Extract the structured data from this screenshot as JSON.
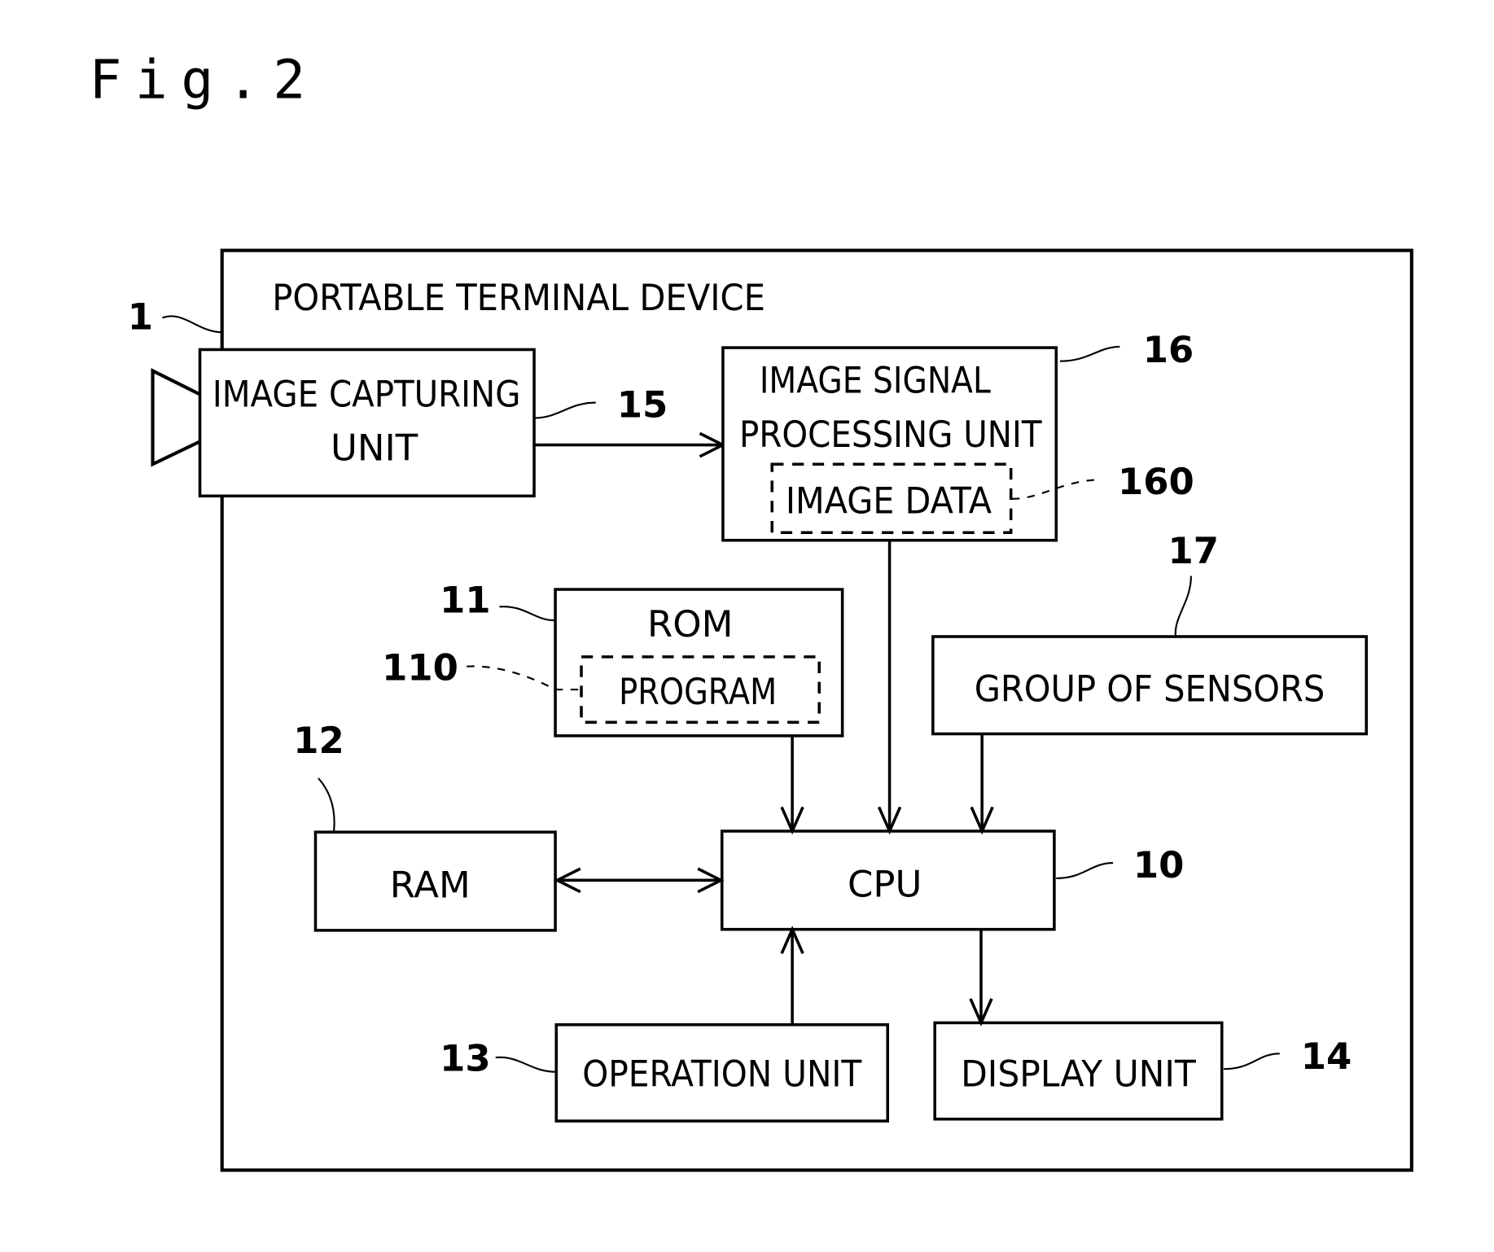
{
  "figure": {
    "title": "Fig.2",
    "device_label": "PORTABLE TERMINAL DEVICE",
    "device_ref": "1"
  },
  "blocks": {
    "image_capturing": {
      "line1": "IMAGE CAPTURING",
      "line2": "UNIT",
      "ref": "15"
    },
    "image_signal": {
      "line1": "IMAGE SIGNAL",
      "line2": "PROCESSING UNIT",
      "ref": "16"
    },
    "image_data": {
      "label": "IMAGE DATA",
      "ref": "160"
    },
    "rom": {
      "label": "ROM",
      "ref": "11"
    },
    "program": {
      "label": "PROGRAM",
      "ref": "110"
    },
    "sensors": {
      "label": "GROUP OF SENSORS",
      "ref": "17"
    },
    "ram": {
      "label": "RAM",
      "ref": "12"
    },
    "cpu": {
      "label": "CPU",
      "ref": "10"
    },
    "operation": {
      "label": "OPERATION UNIT",
      "ref": "13"
    },
    "display": {
      "label": "DISPLAY UNIT",
      "ref": "14"
    }
  },
  "connections": [
    {
      "from": "IMAGE CAPTURING UNIT",
      "to": "IMAGE SIGNAL PROCESSING UNIT",
      "direction": "one-way"
    },
    {
      "from": "IMAGE SIGNAL PROCESSING UNIT",
      "to": "CPU",
      "direction": "one-way"
    },
    {
      "from": "ROM",
      "to": "CPU",
      "direction": "one-way"
    },
    {
      "from": "GROUP OF SENSORS",
      "to": "CPU",
      "direction": "one-way"
    },
    {
      "from": "RAM",
      "to": "CPU",
      "direction": "two-way"
    },
    {
      "from": "OPERATION UNIT",
      "to": "CPU",
      "direction": "one-way"
    },
    {
      "from": "CPU",
      "to": "DISPLAY UNIT",
      "direction": "one-way"
    }
  ]
}
